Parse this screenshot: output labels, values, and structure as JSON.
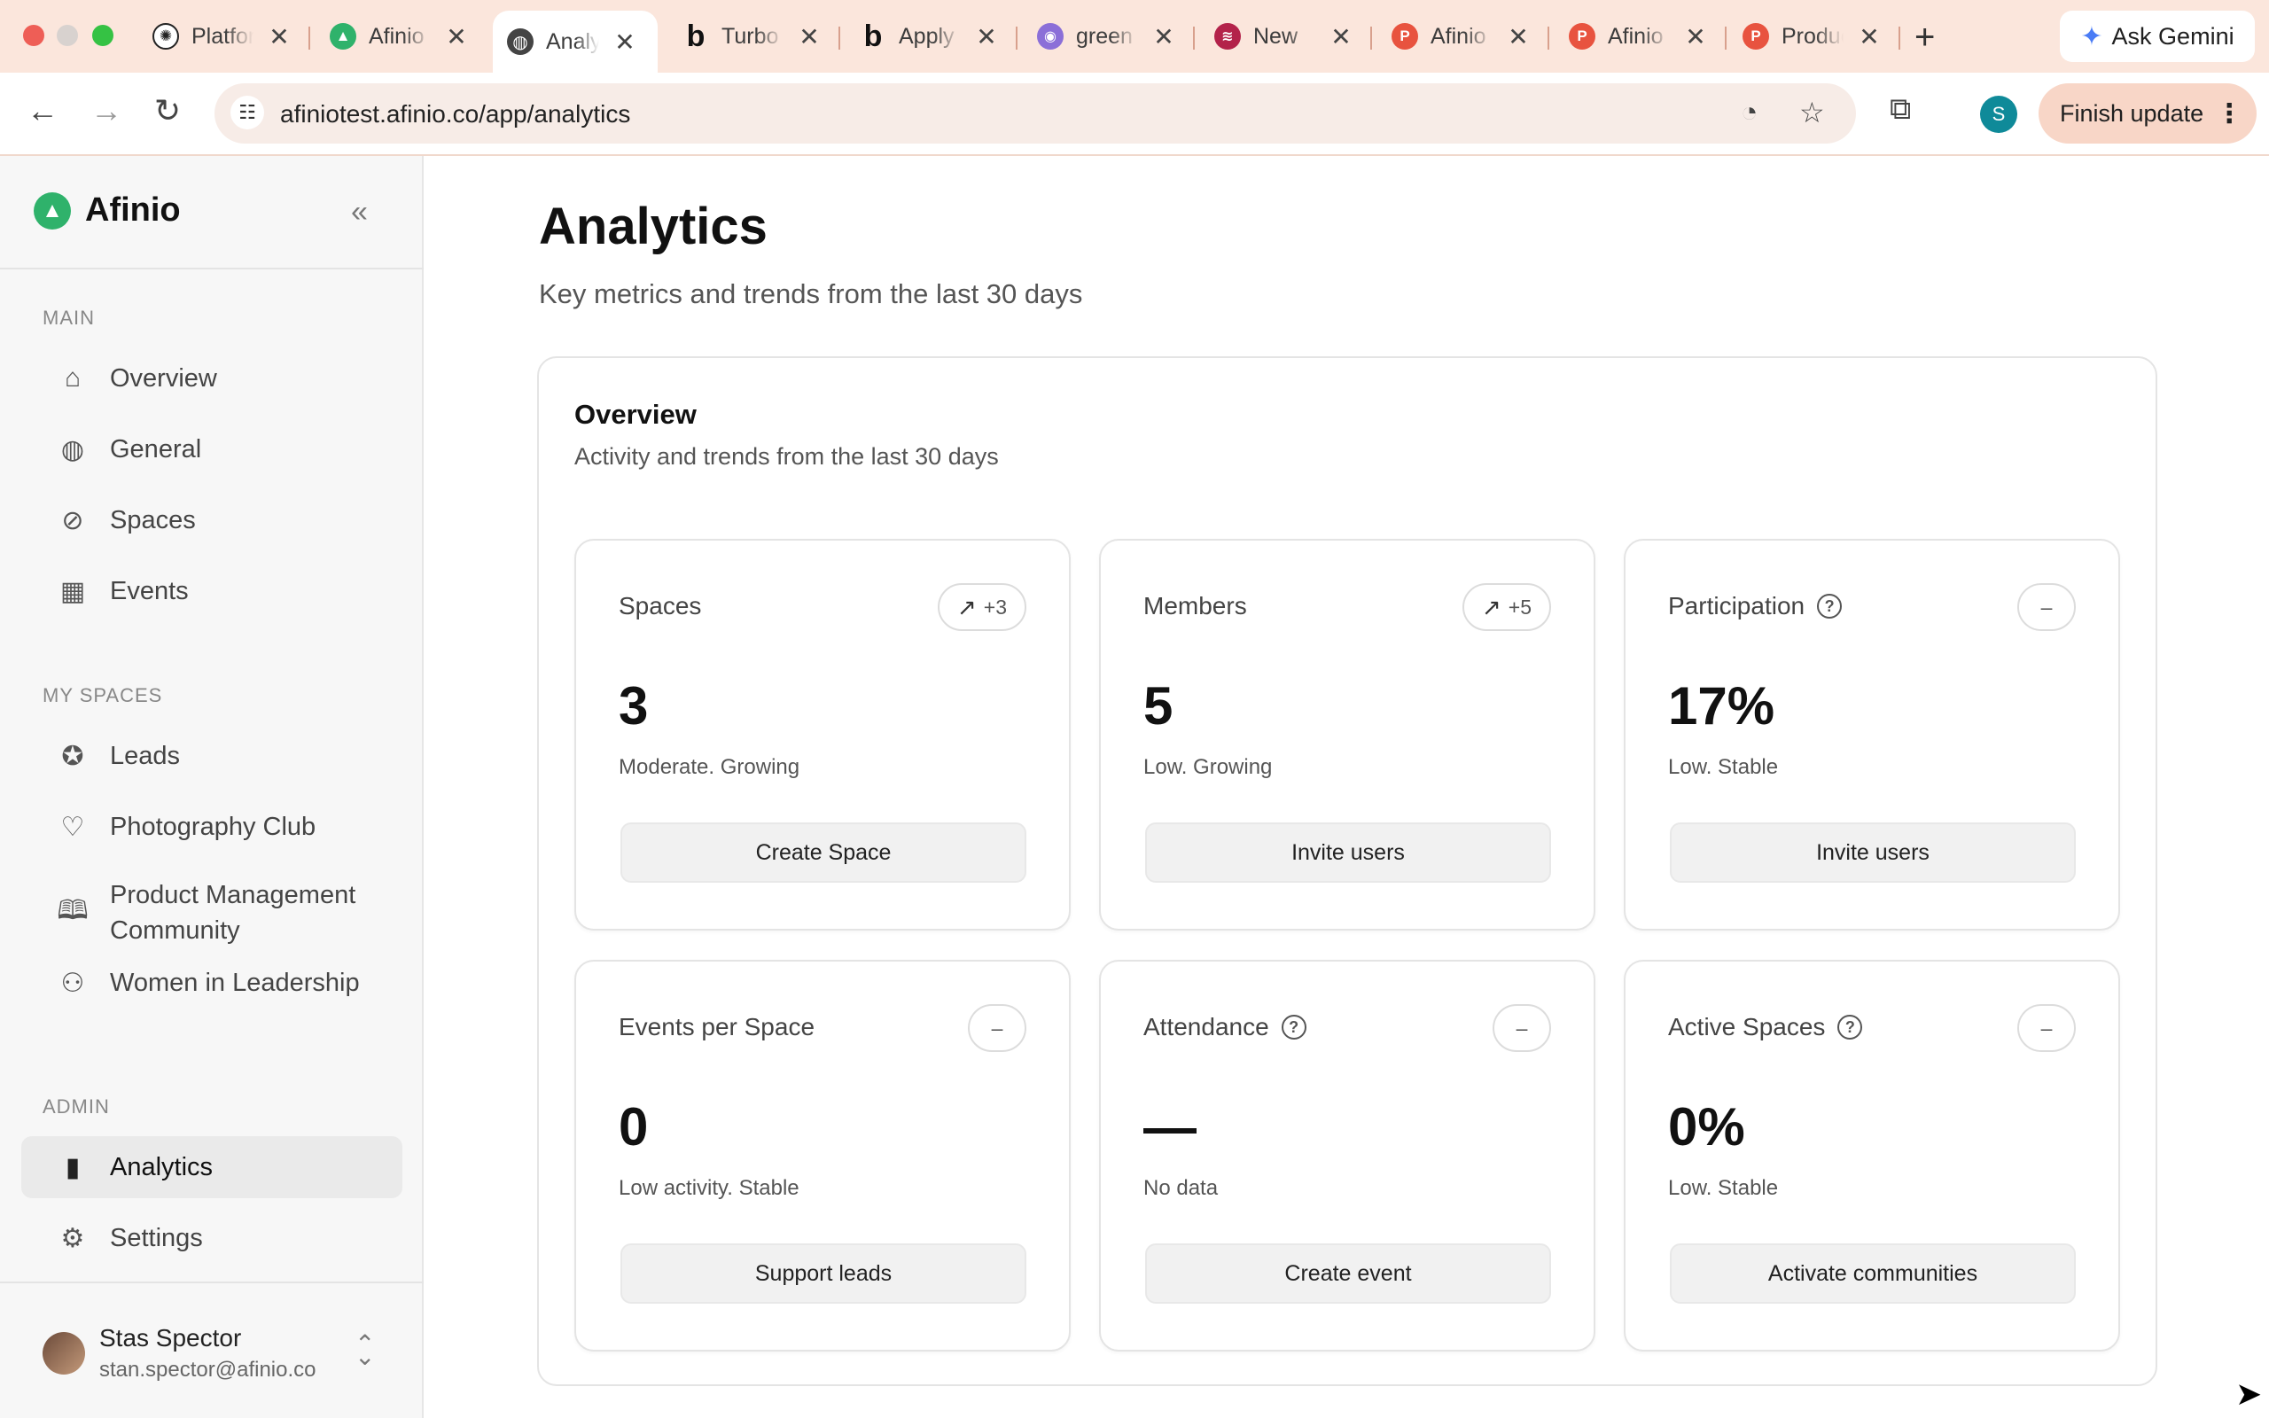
{
  "browser": {
    "tabs": [
      {
        "label": "Platform",
        "favicon": "openai-icon"
      },
      {
        "label": "Afinio",
        "favicon": "afinio-icon"
      },
      {
        "label": "Analytics",
        "favicon": "globe-icon"
      },
      {
        "label": "Turbo",
        "favicon": "b-icon"
      },
      {
        "label": "Apply",
        "favicon": "b-icon"
      },
      {
        "label": "green",
        "favicon": "purple-icon"
      },
      {
        "label": "New",
        "favicon": "red-icon"
      },
      {
        "label": "Afinio",
        "favicon": "p-icon"
      },
      {
        "label": "Afinio",
        "favicon": "p-icon"
      },
      {
        "label": "Product",
        "favicon": "p-icon"
      }
    ],
    "ask_gemini": "Ask Gemini",
    "url": "afiniotest.afinio.co/app/analytics",
    "profile_initial": "S",
    "finish_update": "Finish update"
  },
  "sidebar": {
    "brand": "Afinio",
    "main_label": "MAIN",
    "main_items": [
      {
        "label": "Overview",
        "icon": "home-icon"
      },
      {
        "label": "General",
        "icon": "globe-icon"
      },
      {
        "label": "Spaces",
        "icon": "compass-icon"
      },
      {
        "label": "Events",
        "icon": "calendar-icon"
      }
    ],
    "spaces_label": "MY SPACES",
    "space_items": [
      {
        "label": "Leads",
        "icon": "star-circle-icon"
      },
      {
        "label": "Photography Club",
        "icon": "heart-icon"
      },
      {
        "label": "Product Management Community",
        "icon": "book-icon"
      },
      {
        "label": "Women in Leadership",
        "icon": "users-icon"
      }
    ],
    "admin_label": "ADMIN",
    "admin_items": [
      {
        "label": "Analytics",
        "icon": "bar-chart-icon"
      },
      {
        "label": "Settings",
        "icon": "gear-icon"
      }
    ],
    "user": {
      "name": "Stas Spector",
      "email": "stan.spector@afinio.co"
    }
  },
  "main": {
    "title": "Analytics",
    "subtitle": "Key metrics and trends from the last 30 days",
    "overview": {
      "title": "Overview",
      "subtitle": "Activity and trends from the last 30 days",
      "metrics": [
        {
          "title": "Spaces",
          "badge": "+3",
          "value": "3",
          "status": "Moderate. Growing",
          "action": "Create Space"
        },
        {
          "title": "Members",
          "badge": "+5",
          "value": "5",
          "status": "Low. Growing",
          "action": "Invite users"
        },
        {
          "title": "Participation",
          "badge": "–",
          "value": "17%",
          "status": "Low. Stable",
          "action": "Invite users"
        },
        {
          "title": "Events per Space",
          "badge": "–",
          "value": "0",
          "status": "Low activity. Stable",
          "action": "Support leads"
        },
        {
          "title": "Attendance",
          "badge": "–",
          "value": "—",
          "status": "No data",
          "action": "Create event"
        },
        {
          "title": "Active Spaces",
          "badge": "–",
          "value": "0%",
          "status": "Low. Stable",
          "action": "Activate communities"
        }
      ]
    }
  }
}
